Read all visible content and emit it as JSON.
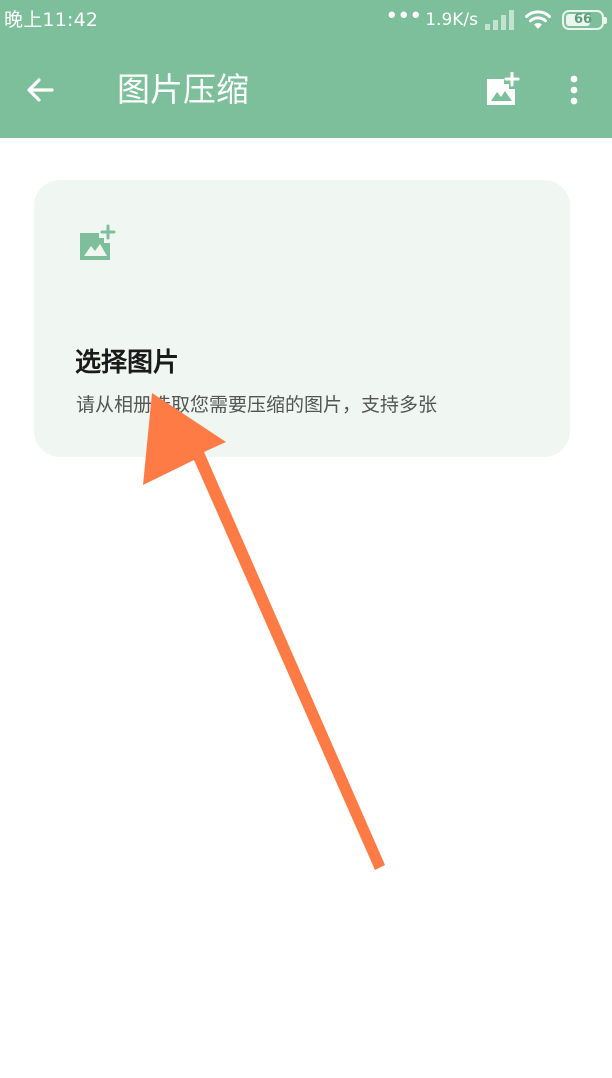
{
  "status_bar": {
    "time": "晚上11:42",
    "dots": "•••",
    "speed": "1.9K/s",
    "battery": "66"
  },
  "toolbar": {
    "title": "图片压缩",
    "back_icon": "arrow-left-icon",
    "add_image_icon": "add-photo-icon",
    "more_icon": "more-vert-icon"
  },
  "card": {
    "icon": "add-photo-icon",
    "title": "选择图片",
    "description": "请从相册选取您需要压缩的图片，支持多张"
  },
  "colors": {
    "toolbar_bg": "#7dbf9b",
    "card_bg": "#f0f6f2",
    "accent": "#7dbf9b",
    "annotation_arrow": "#ff7b45"
  }
}
